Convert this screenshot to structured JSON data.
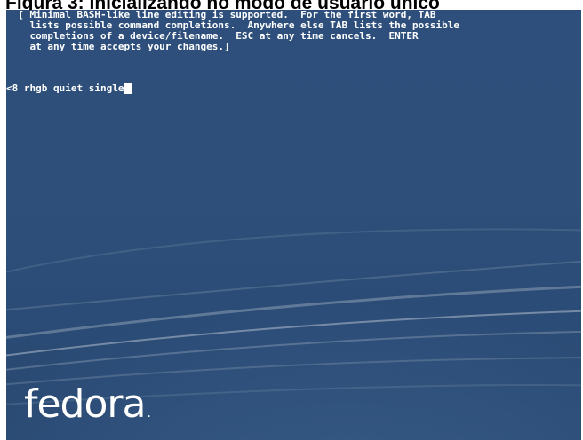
{
  "caption": {
    "text": "Figura 3: Inicializando no modo de usuário único"
  },
  "boot_screen": {
    "help_lines": [
      "  [ Minimal BASH-like line editing is supported.  For the first word, TAB",
      "    lists possible command completions.  Anywhere else TAB lists the possible",
      "    completions of a device/filename.  ESC at any time cancels.  ENTER",
      "    at any time accepts your changes.]"
    ],
    "command_line": "<8 rhgb quiet single",
    "logo_text": "fedora",
    "logo_mark": "."
  },
  "colors": {
    "background": "#2d4f7a",
    "text": "#ffffff"
  }
}
